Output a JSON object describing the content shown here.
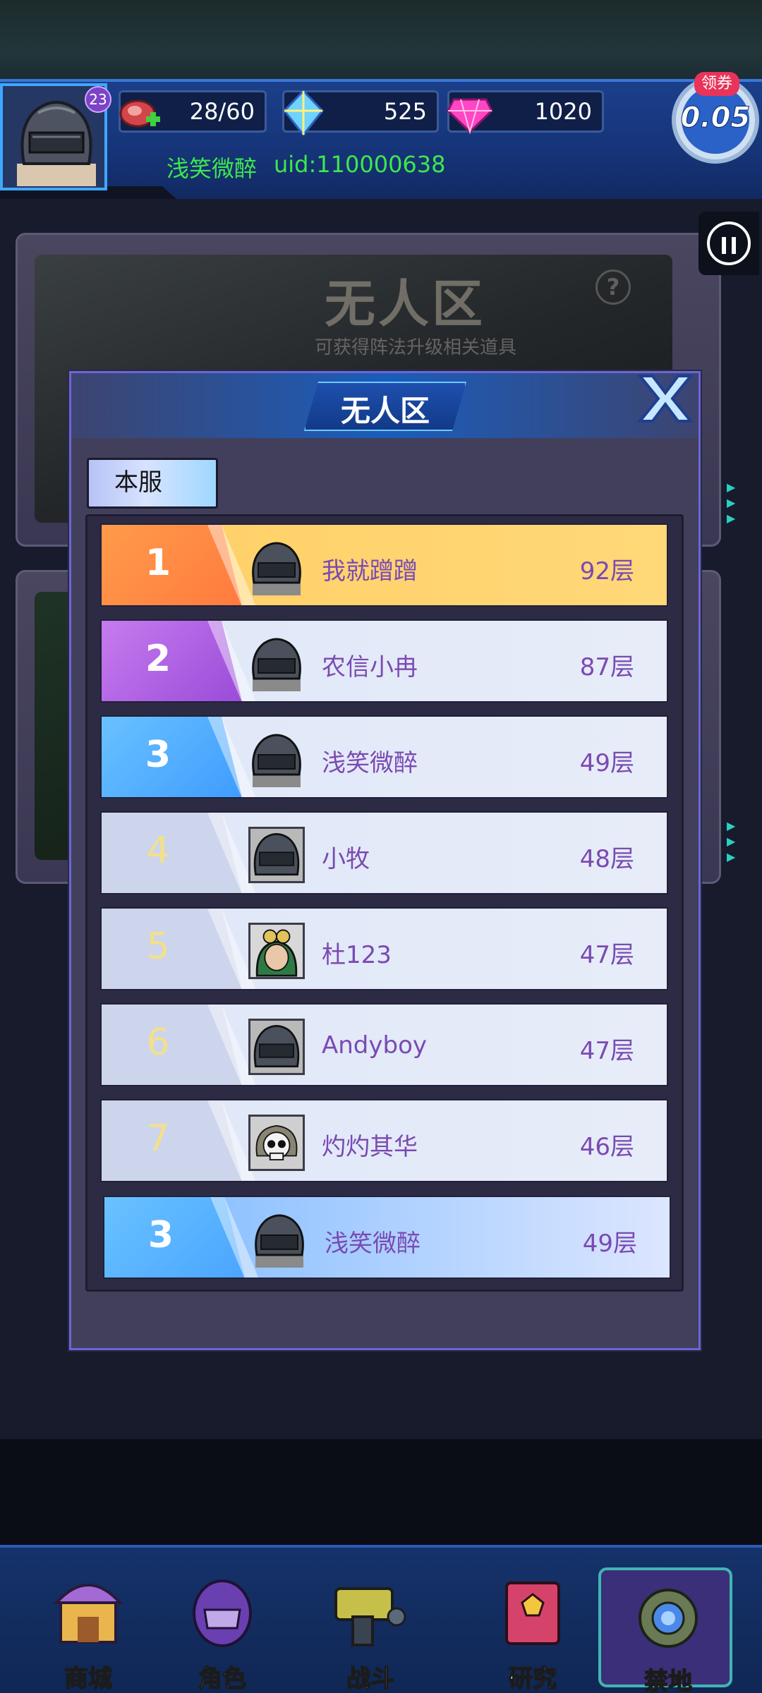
{
  "header": {
    "level": "23",
    "stamina": "28/60",
    "diamonds": "525",
    "gems": "1020",
    "player_name": "浅笑微醉",
    "uid": "uid:110000638",
    "ticket_tag": "领券",
    "ticket_value": "0.05"
  },
  "background_card": {
    "title": "无人区",
    "subtitle": "可获得阵法升级相关道具",
    "help": "?"
  },
  "modal": {
    "title": "无人区",
    "tab": "本服"
  },
  "ranking": [
    {
      "rank": "1",
      "name": "我就蹭蹭",
      "floor": "92层",
      "style": "gold",
      "avatar": "helmet-icon"
    },
    {
      "rank": "2",
      "name": "农信小冉",
      "floor": "87层",
      "style": "purple",
      "avatar": "helmet-icon"
    },
    {
      "rank": "3",
      "name": "浅笑微醉",
      "floor": "49层",
      "style": "blue",
      "avatar": "helmet-icon"
    },
    {
      "rank": "4",
      "name": "小牧",
      "floor": "48层",
      "style": "plain",
      "avatar": "helmet-icon"
    },
    {
      "rank": "5",
      "name": "杜123",
      "floor": "47层",
      "style": "plain",
      "avatar": "goggle-girl-icon"
    },
    {
      "rank": "6",
      "name": "Andyboy",
      "floor": "47层",
      "style": "plain",
      "avatar": "helmet-icon"
    },
    {
      "rank": "7",
      "name": "灼灼其华",
      "floor": "46层",
      "style": "plain",
      "avatar": "skull-icon"
    }
  ],
  "my_rank": {
    "rank": "3",
    "name": "浅笑微醉",
    "floor": "49层"
  },
  "bottom_nav": [
    {
      "label": "商城",
      "icon": "shop-icon"
    },
    {
      "label": "角色",
      "icon": "character-icon"
    },
    {
      "label": "战斗",
      "icon": "battle-gun-icon"
    },
    {
      "label": "研究",
      "icon": "research-book-icon"
    },
    {
      "label": "禁地",
      "icon": "forbidden-land-icon"
    }
  ],
  "colors": {
    "accent_green": "#3de84e",
    "rank_text": "#7a4ab3",
    "gold_row": "#ffd878",
    "header_blue": "#1b3f8a"
  }
}
